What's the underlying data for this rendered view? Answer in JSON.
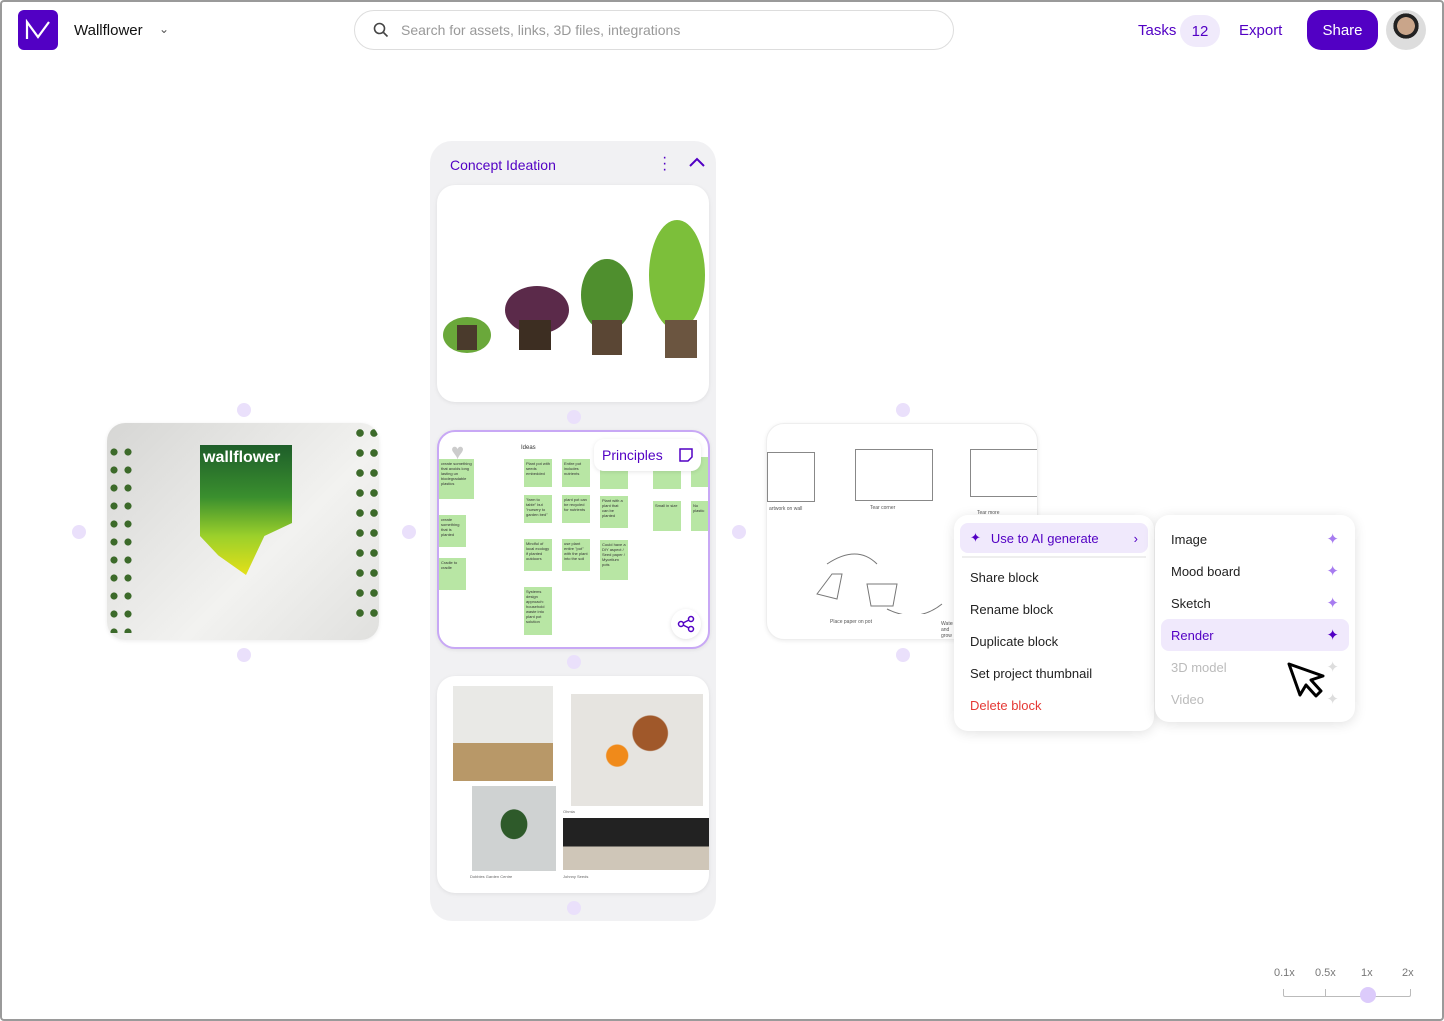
{
  "header": {
    "project_name": "Wallflower",
    "search_placeholder": "Search for assets, links, 3D files, integrations",
    "tasks_label": "Tasks",
    "tasks_count": "12",
    "export_label": "Export",
    "share_label": "Share"
  },
  "column": {
    "title": "Concept Ideation",
    "blocks": [
      {
        "name": "plants-photo"
      },
      {
        "name": "ideas-board",
        "label": "Principles",
        "board_heading": "Ideas",
        "stickies": [
          "create something that avoids long lasting un biodegradable plastics",
          "Plant pot with seeds embedded",
          "Entire pot includes nutrients",
          "create something that is planted",
          "\"farm to table\" but \"nursery to garden bed\"",
          "plant pot can be recycled for nutrients",
          "Plant with a plant that can be planted",
          "Cradle to cradle",
          "Mindful of local ecology if planted outdoors",
          "use plant entire \"pot\" with the plant into the soil",
          "Could have a DIY aspect / Seed paper / Mycelium pots",
          "Systems design approach: household waste into plant pot solution",
          "Small in size",
          "No plastic"
        ]
      },
      {
        "name": "moodboard",
        "captions": [
          "Ohmia",
          "Dobbies Garden Centre",
          "Johnny Seeds"
        ]
      }
    ]
  },
  "left_block": {
    "poster_text": "wallflower"
  },
  "right_block": {
    "captions": [
      "artwork on wall",
      "Tear corner",
      "Tear more",
      "Place paper on pot",
      "Water and grow"
    ]
  },
  "context_menu": {
    "items": [
      {
        "label": "Use to AI generate",
        "icon": "sparkle-icon",
        "highlighted": true
      },
      {
        "label": "Share block"
      },
      {
        "label": "Rename block"
      },
      {
        "label": "Duplicate block"
      },
      {
        "label": "Set project thumbnail"
      },
      {
        "label": "Delete block",
        "danger": true
      }
    ]
  },
  "submenu": {
    "items": [
      {
        "label": "Image"
      },
      {
        "label": "Mood board"
      },
      {
        "label": "Sketch"
      },
      {
        "label": "Render",
        "highlighted": true
      },
      {
        "label": "3D model",
        "disabled": true
      },
      {
        "label": "Video",
        "disabled": true
      }
    ]
  },
  "zoom": {
    "labels": [
      "0.1x",
      "0.5x",
      "1x",
      "2x"
    ],
    "current": "1x"
  },
  "colors": {
    "accent": "#5200c4",
    "accent_light": "#f0e9fc",
    "danger": "#e53935"
  }
}
